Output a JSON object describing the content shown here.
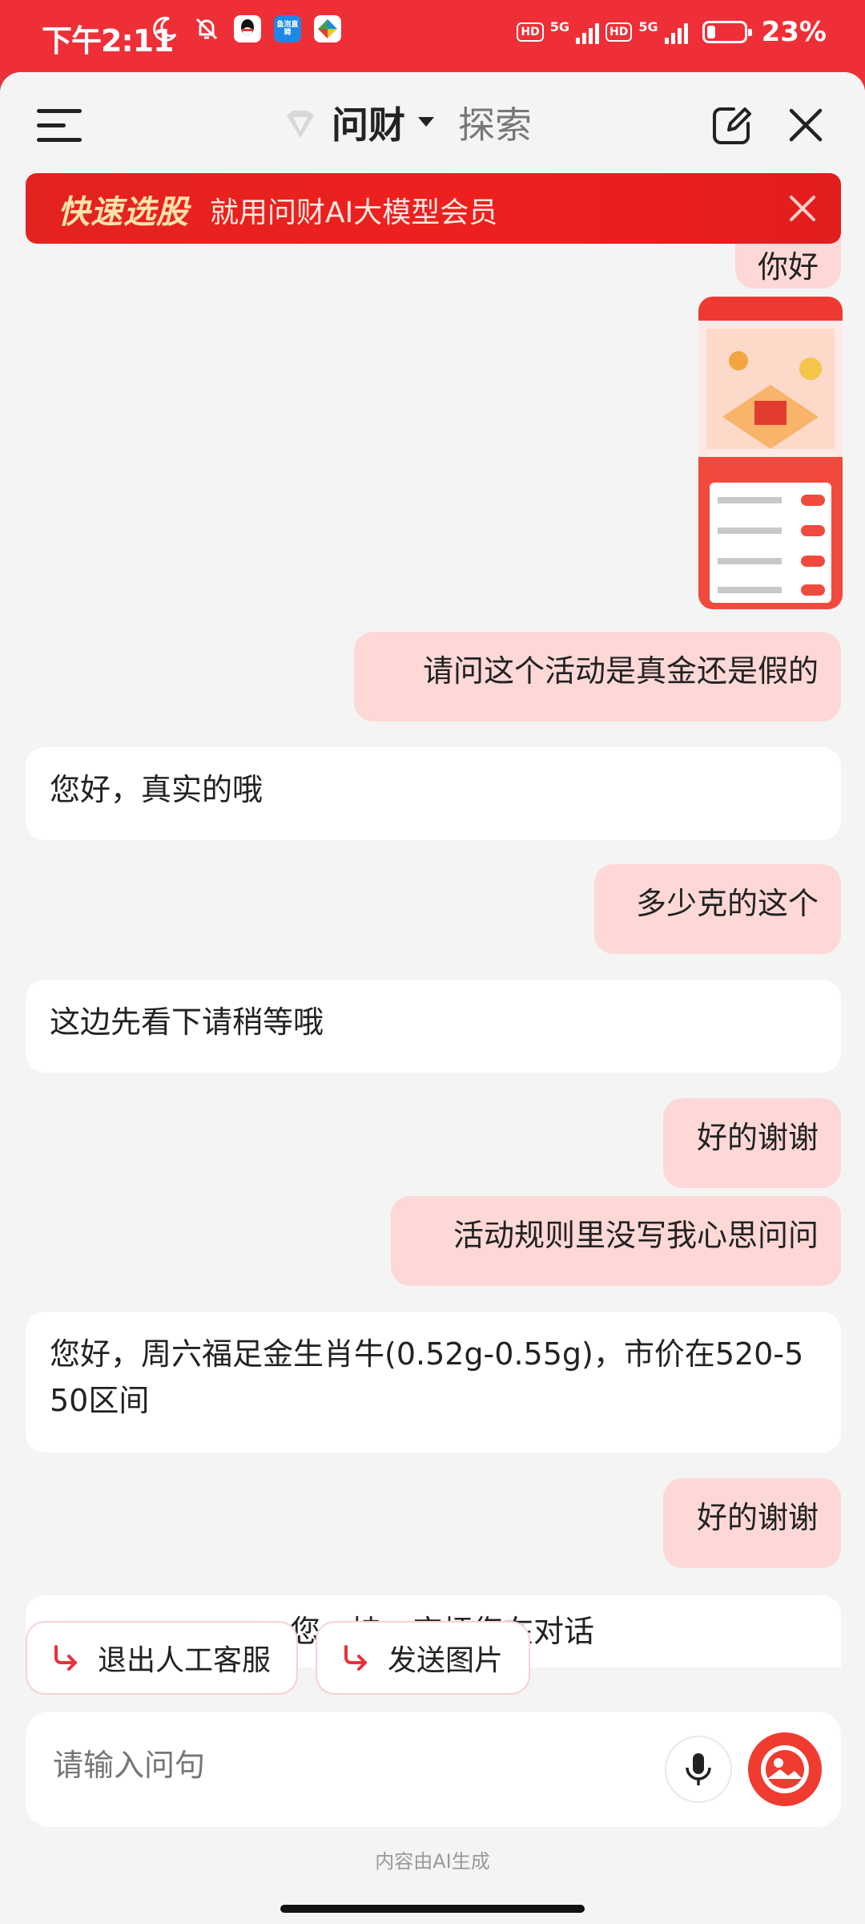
{
  "status_bar": {
    "time": "下午2:11",
    "battery_percent": "23%",
    "network_1": "5G",
    "network_2": "5G",
    "hd_1": "HD",
    "hd_2": "HD",
    "app_icon_2_text": "鱼泡直聘",
    "icons": [
      "moon-icon",
      "bell-off-icon",
      "qq-icon",
      "yupao-icon",
      "multicolor-app-icon"
    ]
  },
  "header": {
    "active_tab": "问财",
    "other_tab": "探索"
  },
  "banner": {
    "title": "快速选股",
    "subtitle": "就用问财AI大模型会员"
  },
  "messages": [
    {
      "role": "user",
      "text": "你好"
    },
    {
      "role": "user",
      "type": "image"
    },
    {
      "role": "user",
      "text": "请问这个活动是真金还是假的"
    },
    {
      "role": "agent",
      "text": "您好，真实的哦"
    },
    {
      "role": "user",
      "text": "多少克的这个"
    },
    {
      "role": "agent",
      "text": "这边先看下请稍等哦"
    },
    {
      "role": "user",
      "text": "好的谢谢"
    },
    {
      "role": "user",
      "text": "活动规则里没写我心思问问"
    },
    {
      "role": "agent",
      "text": "您好，周六福足金生肖牛(0.52g-0.55g)，市价在520-550区间"
    },
    {
      "role": "user",
      "text": "好的谢谢"
    },
    {
      "role": "agent",
      "text": "您…持。麻烦您在对话"
    }
  ],
  "quick_actions": {
    "exit_label": "退出人工客服",
    "send_image_label": "发送图片"
  },
  "input": {
    "placeholder": "请输入问句"
  },
  "footer": {
    "note": "内容由AI生成"
  },
  "colors": {
    "brand_red": "#ee2f37",
    "user_bubble": "#fdd8d6",
    "bot_bubble": "#ffffff",
    "background": "#f4f4f4"
  }
}
